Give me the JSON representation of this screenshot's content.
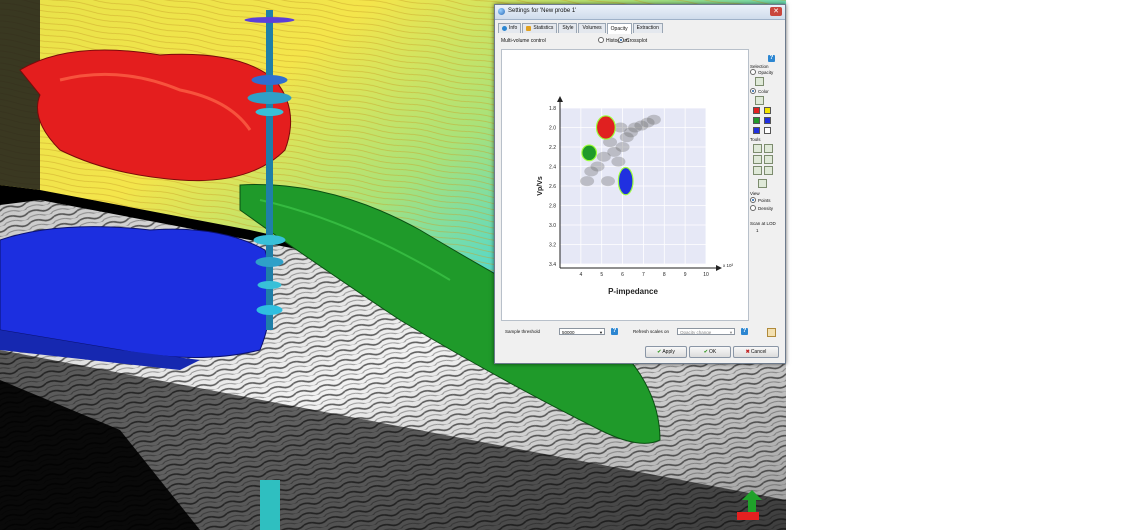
{
  "dialog": {
    "title": "Settings for 'New probe 1'",
    "close_glyph": "✕",
    "tabs": [
      {
        "label": "Info",
        "icon": "info-icon",
        "active": false
      },
      {
        "label": "Statistics",
        "icon": "stats-icon",
        "active": false
      },
      {
        "label": "Style",
        "active": false
      },
      {
        "label": "Volumes",
        "active": false
      },
      {
        "label": "Opacity",
        "active": true
      },
      {
        "label": "Extraction",
        "active": false
      }
    ],
    "mode": {
      "label": "Multi-volume control",
      "options": [
        {
          "label": "Histogram",
          "selected": false
        },
        {
          "label": "Crossplot",
          "selected": true
        }
      ]
    },
    "side_panel": {
      "selection_title": "Selection",
      "opacity_label": "Opacity",
      "color_label": "Color",
      "colors": [
        "#e02020",
        "#f2e400",
        "#1f9a2a",
        "#2030e0",
        "#2030e0",
        "#ffffff"
      ],
      "tools_title": "Tools",
      "view_title": "View",
      "view_options": [
        {
          "label": "Points",
          "selected": true
        },
        {
          "label": "Density",
          "selected": false
        }
      ],
      "scan_label": "Scan at LOD",
      "scan_value": "1"
    },
    "bottom": {
      "threshold_label": "Sample threshold",
      "threshold_value": "50000",
      "refresh_label": "Refresh scales on",
      "refresh_value": "Opacity change"
    },
    "buttons": {
      "apply": "Apply",
      "ok": "OK",
      "cancel": "Cancel"
    }
  },
  "chart_data": {
    "type": "scatter",
    "xlabel": "P-impedance",
    "ylabel": "Vp/Vs",
    "x_scale_label": "x 10³",
    "xlim": [
      3,
      10
    ],
    "ylim": [
      1.8,
      3.4
    ],
    "y_inverted": true,
    "x_ticks": [
      "4",
      "5",
      "6",
      "7",
      "8",
      "9",
      "10"
    ],
    "y_ticks": [
      "1.8",
      "2.0",
      "2.2",
      "2.4",
      "2.6",
      "2.8",
      "3.0",
      "3.2",
      "3.4"
    ],
    "grid": true,
    "point_cloud": [
      {
        "x": 4.3,
        "y": 2.55
      },
      {
        "x": 4.5,
        "y": 2.45
      },
      {
        "x": 4.8,
        "y": 2.4
      },
      {
        "x": 5.1,
        "y": 2.3
      },
      {
        "x": 5.3,
        "y": 2.55
      },
      {
        "x": 5.6,
        "y": 2.25
      },
      {
        "x": 5.8,
        "y": 2.35
      },
      {
        "x": 6.0,
        "y": 2.2
      },
      {
        "x": 6.2,
        "y": 2.1
      },
      {
        "x": 6.4,
        "y": 2.05
      },
      {
        "x": 6.6,
        "y": 2.0
      },
      {
        "x": 6.9,
        "y": 1.98
      },
      {
        "x": 7.2,
        "y": 1.95
      },
      {
        "x": 7.5,
        "y": 1.92
      },
      {
        "x": 5.4,
        "y": 2.15
      },
      {
        "x": 5.9,
        "y": 2.0
      }
    ],
    "clusters": [
      {
        "color": "#2030e0",
        "cx": 6.15,
        "cy": 2.55,
        "rx": 0.35,
        "ry": 0.14
      },
      {
        "color": "#1f9a2a",
        "cx": 4.4,
        "cy": 2.26,
        "rx": 0.35,
        "ry": 0.08
      },
      {
        "color": "#e02020",
        "cx": 5.2,
        "cy": 2.0,
        "rx": 0.45,
        "ry": 0.12
      }
    ]
  }
}
